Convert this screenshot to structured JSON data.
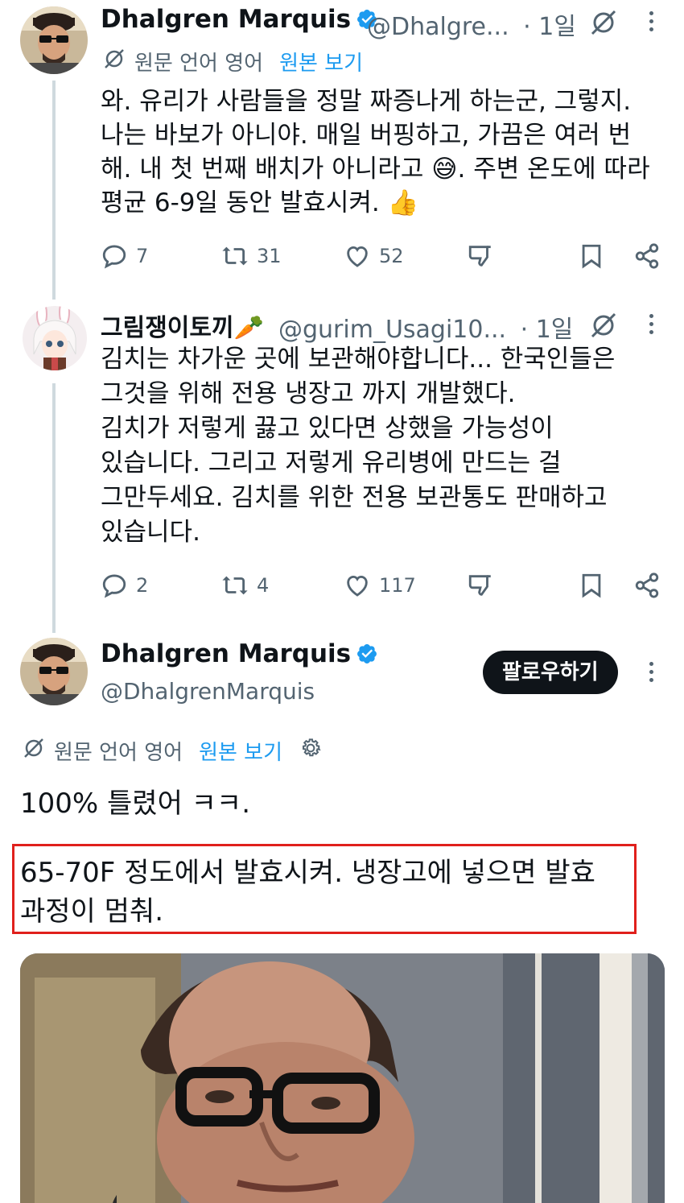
{
  "tweet1": {
    "name": "Dhalgren Marquis",
    "handle": "@Dhalgre...",
    "time": "· 1일",
    "translate_status": "원문 언어 영어",
    "translate_link": "원본 보기",
    "text": "와. 유리가 사람들을 정말 짜증나게 하는군, 그렇지.\n나는 바보가 아니야. 매일 버핑하고, 가끔은 여러 번\n해. 내 첫 번째 배치가 아니라고 😅. 주변 온도에 따라\n평균 6-9일 동안 발효시켜. 👍",
    "replies": "7",
    "reposts": "31",
    "likes": "52"
  },
  "tweet2": {
    "name": "그림쟁이토끼🥕",
    "handle": "@gurim_Usagi10...",
    "time": "· 1일",
    "text": "김치는 차가운 곳에 보관해야합니다... 한국인들은\n그것을 위해 전용 냉장고 까지 개발했다.\n김치가 저렇게 끓고 있다면 상했을 가능성이\n있습니다. 그리고 저렇게 유리병에 만드는 걸\n그만두세요. 김치를 위한 전용 보관통도 판매하고\n있습니다.",
    "replies": "2",
    "reposts": "4",
    "likes": "117"
  },
  "tweet3": {
    "name": "Dhalgren Marquis",
    "handle": "@DhalgrenMarquis",
    "follow_label": "팔로우하기",
    "translate_status": "원문 언어 영어",
    "translate_link": "원본 보기",
    "text_line1": "100% 틀렸어 ㅋㅋ.",
    "text_highlight": "65-70F 정도에서 발효시켜. 냉장고에 넣으면 발효\n과정이 멈춰."
  },
  "colors": {
    "text": "#0f1419",
    "secondary": "#536471",
    "link": "#1d9bf0",
    "verified": "#1d9bf0",
    "highlight_border": "#e0201c",
    "thread_line": "#cfd9de"
  },
  "icons": [
    "verified-badge-icon",
    "grok-icon",
    "more-dots-icon",
    "translate-icon",
    "reply-icon",
    "repost-icon",
    "like-icon",
    "dislike-icon",
    "bookmark-icon",
    "share-icon",
    "settings-gear-icon"
  ]
}
